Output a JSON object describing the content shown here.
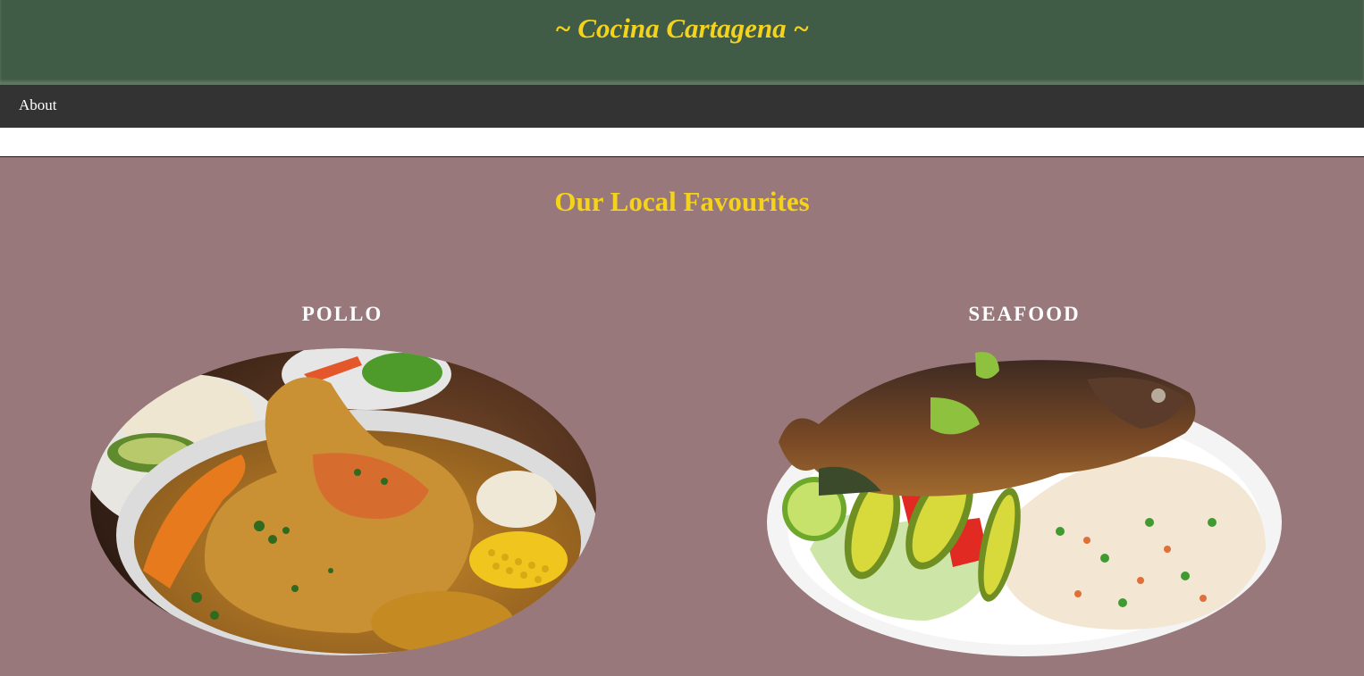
{
  "header": {
    "title": "~ Cocina Cartagena ~"
  },
  "nav": {
    "items": [
      {
        "label": "About"
      }
    ]
  },
  "main": {
    "section_title": "Our Local Favourites",
    "dishes": [
      {
        "name": "POLLO",
        "image_alt": "pollo dish"
      },
      {
        "name": "SEAFOOD",
        "image_alt": "seafood dish"
      }
    ]
  },
  "colors": {
    "header_bg": "#415c46",
    "nav_bg": "#333333",
    "accent_gold": "#f5d31c",
    "section_bg": "#98787b"
  }
}
